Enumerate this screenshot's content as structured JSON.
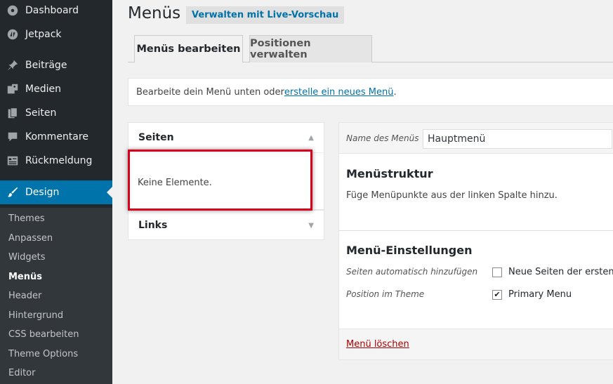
{
  "sidebar": {
    "items": [
      {
        "label": "Dashboard",
        "icon": "dashboard-icon"
      },
      {
        "label": "Jetpack",
        "icon": "jetpack-icon"
      },
      {
        "label": "Beiträge",
        "icon": "pin-icon"
      },
      {
        "label": "Medien",
        "icon": "media-icon"
      },
      {
        "label": "Seiten",
        "icon": "pages-icon"
      },
      {
        "label": "Kommentare",
        "icon": "comment-icon"
      },
      {
        "label": "Rückmeldung",
        "icon": "feedback-icon"
      },
      {
        "label": "Design",
        "icon": "paintbrush-icon"
      }
    ],
    "submenu": [
      "Themes",
      "Anpassen",
      "Widgets",
      "Menüs",
      "Header",
      "Hintergrund",
      "CSS bearbeiten",
      "Theme Options",
      "Editor"
    ]
  },
  "header": {
    "title": "Menüs",
    "live_preview": "Verwalten mit Live-Vorschau"
  },
  "tabs": [
    "Menüs bearbeiten",
    "Positionen verwalten"
  ],
  "notice": {
    "text_before": "Bearbeite dein Menü unten oder ",
    "link": "erstelle ein neues Menü",
    "text_after": "."
  },
  "left": {
    "pages_title": "Seiten",
    "no_items": "Keine Elemente.",
    "links_title": "Links"
  },
  "menu": {
    "name_label": "Name des Menüs",
    "name_value": "Hauptmenü",
    "structure_title": "Menüstruktur",
    "structure_desc": "Füge Menüpunkte aus der linken Spalte hinzu.",
    "settings_title": "Menü-Einstellungen",
    "auto_add_label": "Seiten automatisch hinzufügen",
    "auto_add_option": "Neue Seiten der ersten E",
    "auto_add_checked": false,
    "position_label": "Position im Theme",
    "position_option": "Primary Menu",
    "position_checked": true,
    "delete": "Menü löschen"
  },
  "colors": {
    "sidebar_bg": "#23282d",
    "active_bg": "#0073aa",
    "highlight": "#d9001b",
    "link": "#0073aa",
    "delete": "#aa0000"
  }
}
